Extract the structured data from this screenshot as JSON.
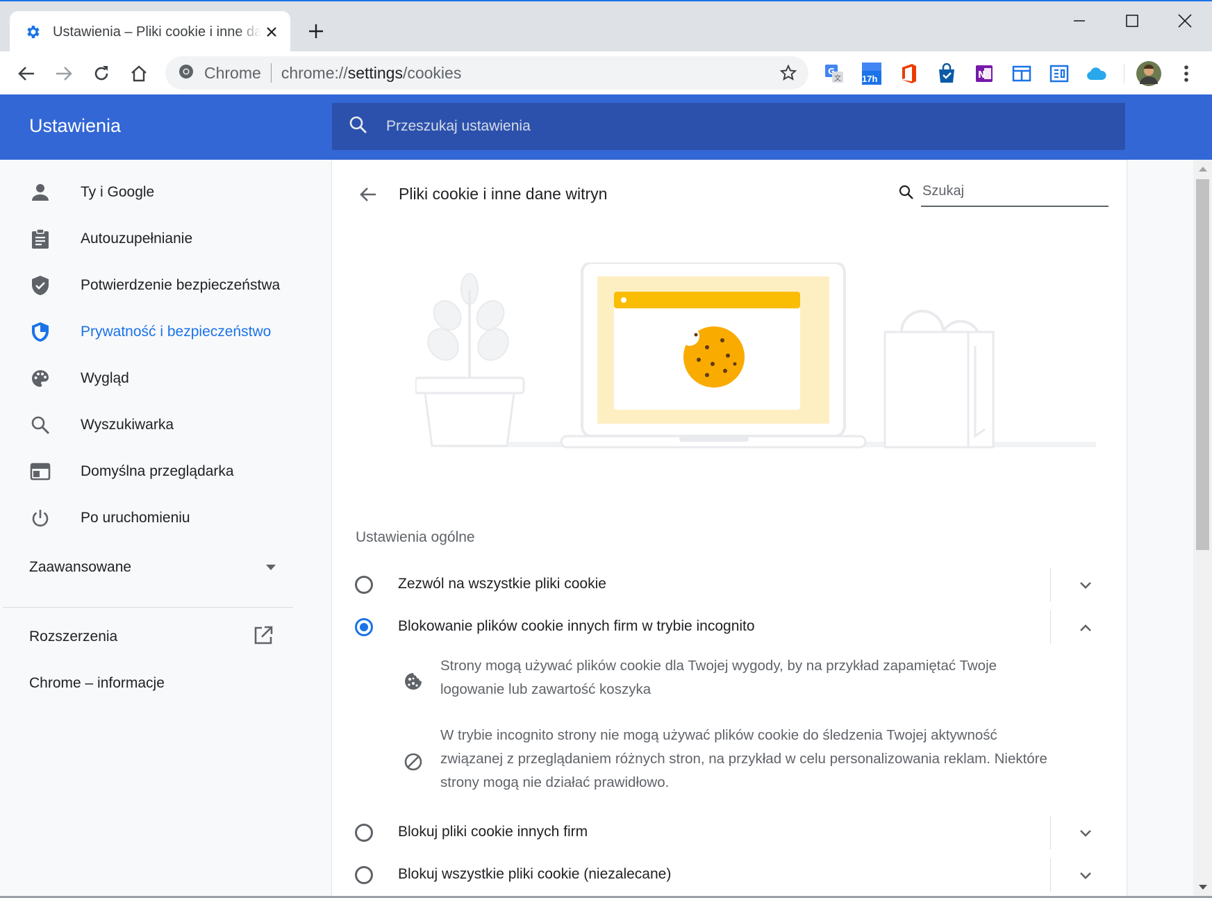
{
  "browser": {
    "tab_title": "Ustawienia – Pliki cookie i inne dane witryn",
    "omnibox_site": "Chrome",
    "omnibox_url_prefix": "chrome://",
    "omnibox_url_path": "settings",
    "omnibox_url_suffix": "/cookies",
    "calendar_badge": "17h",
    "accent_color": "#1a73e8"
  },
  "header": {
    "title": "Ustawienia",
    "search_placeholder": "Przeszukaj ustawienia",
    "color": "#3367d6"
  },
  "sidebar": {
    "items": [
      {
        "label": "Ty i Google",
        "icon": "person-icon"
      },
      {
        "label": "Autouzupełnianie",
        "icon": "clipboard-icon"
      },
      {
        "label": "Potwierdzenie bezpieczeństwa",
        "icon": "shield-check-icon"
      },
      {
        "label": "Prywatność i bezpieczeństwo",
        "icon": "shield-icon",
        "active": true
      },
      {
        "label": "Wygląd",
        "icon": "palette-icon"
      },
      {
        "label": "Wyszukiwarka",
        "icon": "search-icon"
      },
      {
        "label": "Domyślna przeglądarka",
        "icon": "browser-window-icon"
      },
      {
        "label": "Po uruchomieniu",
        "icon": "power-icon"
      }
    ],
    "advanced_label": "Zaawansowane",
    "extensions_label": "Rozszerzenia",
    "about_label": "Chrome – informacje"
  },
  "main": {
    "page_title": "Pliki cookie i inne dane witryn",
    "search_placeholder": "Szukaj",
    "section_title": "Ustawienia ogólne",
    "options": [
      {
        "label": "Zezwól na wszystkie pliki cookie",
        "selected": false,
        "expanded": false
      },
      {
        "label": "Blokowanie plików cookie innych firm w trybie incognito",
        "selected": true,
        "expanded": true
      },
      {
        "label": "Blokuj pliki cookie innych firm",
        "selected": false,
        "expanded": false
      },
      {
        "label": "Blokuj wszystkie pliki cookie (niezalecane)",
        "selected": false,
        "expanded": false
      }
    ],
    "details": [
      {
        "icon": "cookie-icon",
        "text": "Strony mogą używać plików cookie dla Twojej wygody, by na przykład zapamiętać Twoje logowanie lub zawartość koszyka"
      },
      {
        "icon": "block-icon",
        "text": "W trybie incognito strony nie mogą używać plików cookie do śledzenia Twojej aktywność związanej z przeglądaniem różnych stron, na przykład w celu personalizowania reklam. Niektóre strony mogą nie działać prawidłowo."
      }
    ]
  }
}
